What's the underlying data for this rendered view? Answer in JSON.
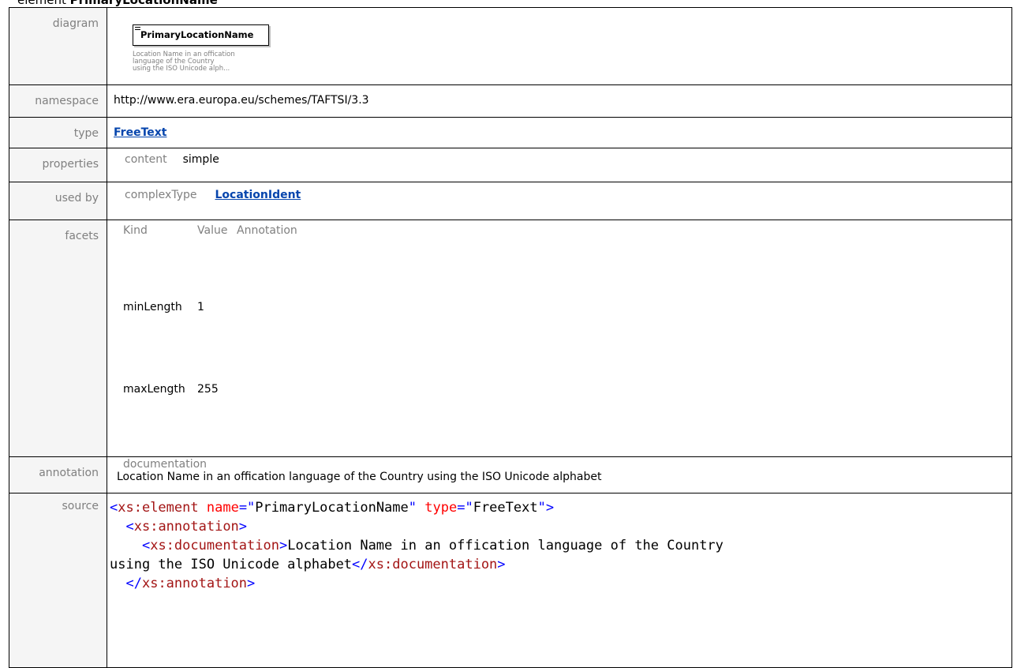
{
  "title": {
    "prefix": "element",
    "name": "PrimaryLocationName"
  },
  "rows": {
    "diagram": {
      "label": "diagram",
      "box_name": "PrimaryLocationName",
      "doc_lines": [
        "Location Name in an offication",
        "language of the Country",
        "using the ISO Unicode alph..."
      ]
    },
    "namespace": {
      "label": "namespace",
      "value": "http://www.era.europa.eu/schemes/TAFTSI/3.3"
    },
    "type": {
      "label": "type",
      "value": "FreeText"
    },
    "properties": {
      "label": "properties",
      "key": "content",
      "value": "simple"
    },
    "used_by": {
      "label": "used by",
      "key": "complexType",
      "value": "LocationIdent"
    },
    "facets": {
      "label": "facets",
      "headers": [
        "Kind",
        "Value",
        "Annotation"
      ],
      "items": [
        {
          "kind": "minLength",
          "value": "1",
          "annotation": ""
        },
        {
          "kind": "maxLength",
          "value": "255",
          "annotation": ""
        }
      ]
    },
    "annotation": {
      "label": "annotation",
      "key": "documentation",
      "value": "Location Name in an offication language of the Country using the ISO Unicode alphabet"
    },
    "source": {
      "label": "source",
      "l1_open": "<",
      "l1_tag": "xs:element",
      "l1_a1": "name",
      "l1_eq1": "=\"",
      "l1_v1": "PrimaryLocationName",
      "l1_q1": "\"",
      "l1_a2": "type",
      "l1_eq2": "=\"",
      "l1_v2": "FreeText",
      "l1_close": "\">",
      "l2_open": "<",
      "l2_tag": "xs:annotation",
      "l2_close": ">",
      "l3_open": "<",
      "l3_tag": "xs:documentation",
      "l3_close": ">",
      "l3_text": "Location Name in an offication language of the Country",
      "l4_text": "using the ISO Unicode alphabet",
      "l4_open": "</",
      "l4_tag": "xs:documentation",
      "l4_close": ">",
      "l5_open": "</",
      "l5_tag": "xs:annotation",
      "l5_close": ">"
    }
  },
  "colors": {
    "label_text": "#808080",
    "label_bg": "#f5f5f5",
    "link": "#0645ad",
    "xml_bracket": "#0000ff",
    "xml_tag": "#a31515",
    "xml_attr": "#ff0000"
  }
}
